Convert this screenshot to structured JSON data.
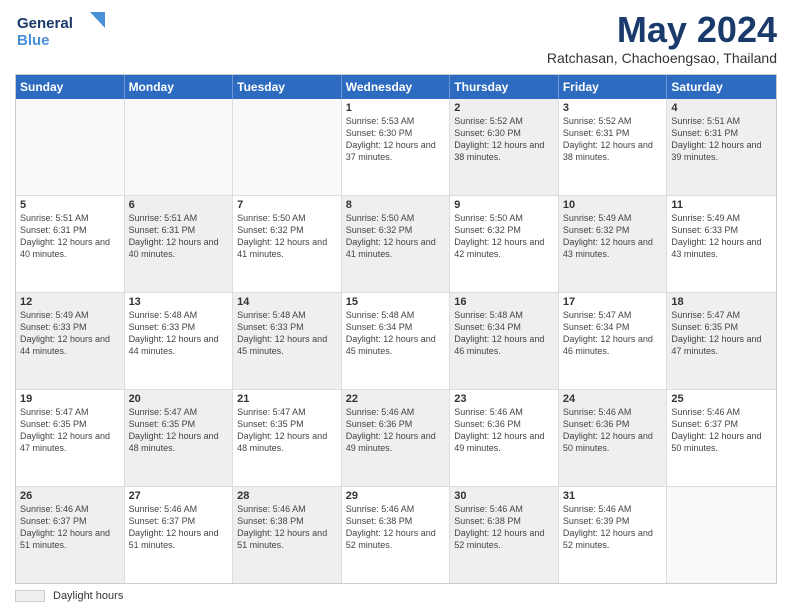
{
  "header": {
    "logo_line1": "General",
    "logo_line2": "Blue",
    "title": "May 2024",
    "subtitle": "Ratchasan, Chachoengsao, Thailand"
  },
  "calendar": {
    "days_of_week": [
      "Sunday",
      "Monday",
      "Tuesday",
      "Wednesday",
      "Thursday",
      "Friday",
      "Saturday"
    ],
    "rows": [
      [
        {
          "day": "",
          "info": "",
          "empty": true
        },
        {
          "day": "",
          "info": "",
          "empty": true
        },
        {
          "day": "",
          "info": "",
          "empty": true
        },
        {
          "day": "1",
          "info": "Sunrise: 5:53 AM\nSunset: 6:30 PM\nDaylight: 12 hours\nand 37 minutes.",
          "empty": false,
          "shaded": false
        },
        {
          "day": "2",
          "info": "Sunrise: 5:52 AM\nSunset: 6:30 PM\nDaylight: 12 hours\nand 38 minutes.",
          "empty": false,
          "shaded": true
        },
        {
          "day": "3",
          "info": "Sunrise: 5:52 AM\nSunset: 6:31 PM\nDaylight: 12 hours\nand 38 minutes.",
          "empty": false,
          "shaded": false
        },
        {
          "day": "4",
          "info": "Sunrise: 5:51 AM\nSunset: 6:31 PM\nDaylight: 12 hours\nand 39 minutes.",
          "empty": false,
          "shaded": true
        }
      ],
      [
        {
          "day": "5",
          "info": "Sunrise: 5:51 AM\nSunset: 6:31 PM\nDaylight: 12 hours\nand 40 minutes.",
          "empty": false,
          "shaded": false
        },
        {
          "day": "6",
          "info": "Sunrise: 5:51 AM\nSunset: 6:31 PM\nDaylight: 12 hours\nand 40 minutes.",
          "empty": false,
          "shaded": true
        },
        {
          "day": "7",
          "info": "Sunrise: 5:50 AM\nSunset: 6:32 PM\nDaylight: 12 hours\nand 41 minutes.",
          "empty": false,
          "shaded": false
        },
        {
          "day": "8",
          "info": "Sunrise: 5:50 AM\nSunset: 6:32 PM\nDaylight: 12 hours\nand 41 minutes.",
          "empty": false,
          "shaded": true
        },
        {
          "day": "9",
          "info": "Sunrise: 5:50 AM\nSunset: 6:32 PM\nDaylight: 12 hours\nand 42 minutes.",
          "empty": false,
          "shaded": false
        },
        {
          "day": "10",
          "info": "Sunrise: 5:49 AM\nSunset: 6:32 PM\nDaylight: 12 hours\nand 43 minutes.",
          "empty": false,
          "shaded": true
        },
        {
          "day": "11",
          "info": "Sunrise: 5:49 AM\nSunset: 6:33 PM\nDaylight: 12 hours\nand 43 minutes.",
          "empty": false,
          "shaded": false
        }
      ],
      [
        {
          "day": "12",
          "info": "Sunrise: 5:49 AM\nSunset: 6:33 PM\nDaylight: 12 hours\nand 44 minutes.",
          "empty": false,
          "shaded": true
        },
        {
          "day": "13",
          "info": "Sunrise: 5:48 AM\nSunset: 6:33 PM\nDaylight: 12 hours\nand 44 minutes.",
          "empty": false,
          "shaded": false
        },
        {
          "day": "14",
          "info": "Sunrise: 5:48 AM\nSunset: 6:33 PM\nDaylight: 12 hours\nand 45 minutes.",
          "empty": false,
          "shaded": true
        },
        {
          "day": "15",
          "info": "Sunrise: 5:48 AM\nSunset: 6:34 PM\nDaylight: 12 hours\nand 45 minutes.",
          "empty": false,
          "shaded": false
        },
        {
          "day": "16",
          "info": "Sunrise: 5:48 AM\nSunset: 6:34 PM\nDaylight: 12 hours\nand 46 minutes.",
          "empty": false,
          "shaded": true
        },
        {
          "day": "17",
          "info": "Sunrise: 5:47 AM\nSunset: 6:34 PM\nDaylight: 12 hours\nand 46 minutes.",
          "empty": false,
          "shaded": false
        },
        {
          "day": "18",
          "info": "Sunrise: 5:47 AM\nSunset: 6:35 PM\nDaylight: 12 hours\nand 47 minutes.",
          "empty": false,
          "shaded": true
        }
      ],
      [
        {
          "day": "19",
          "info": "Sunrise: 5:47 AM\nSunset: 6:35 PM\nDaylight: 12 hours\nand 47 minutes.",
          "empty": false,
          "shaded": false
        },
        {
          "day": "20",
          "info": "Sunrise: 5:47 AM\nSunset: 6:35 PM\nDaylight: 12 hours\nand 48 minutes.",
          "empty": false,
          "shaded": true
        },
        {
          "day": "21",
          "info": "Sunrise: 5:47 AM\nSunset: 6:35 PM\nDaylight: 12 hours\nand 48 minutes.",
          "empty": false,
          "shaded": false
        },
        {
          "day": "22",
          "info": "Sunrise: 5:46 AM\nSunset: 6:36 PM\nDaylight: 12 hours\nand 49 minutes.",
          "empty": false,
          "shaded": true
        },
        {
          "day": "23",
          "info": "Sunrise: 5:46 AM\nSunset: 6:36 PM\nDaylight: 12 hours\nand 49 minutes.",
          "empty": false,
          "shaded": false
        },
        {
          "day": "24",
          "info": "Sunrise: 5:46 AM\nSunset: 6:36 PM\nDaylight: 12 hours\nand 50 minutes.",
          "empty": false,
          "shaded": true
        },
        {
          "day": "25",
          "info": "Sunrise: 5:46 AM\nSunset: 6:37 PM\nDaylight: 12 hours\nand 50 minutes.",
          "empty": false,
          "shaded": false
        }
      ],
      [
        {
          "day": "26",
          "info": "Sunrise: 5:46 AM\nSunset: 6:37 PM\nDaylight: 12 hours\nand 51 minutes.",
          "empty": false,
          "shaded": true
        },
        {
          "day": "27",
          "info": "Sunrise: 5:46 AM\nSunset: 6:37 PM\nDaylight: 12 hours\nand 51 minutes.",
          "empty": false,
          "shaded": false
        },
        {
          "day": "28",
          "info": "Sunrise: 5:46 AM\nSunset: 6:38 PM\nDaylight: 12 hours\nand 51 minutes.",
          "empty": false,
          "shaded": true
        },
        {
          "day": "29",
          "info": "Sunrise: 5:46 AM\nSunset: 6:38 PM\nDaylight: 12 hours\nand 52 minutes.",
          "empty": false,
          "shaded": false
        },
        {
          "day": "30",
          "info": "Sunrise: 5:46 AM\nSunset: 6:38 PM\nDaylight: 12 hours\nand 52 minutes.",
          "empty": false,
          "shaded": true
        },
        {
          "day": "31",
          "info": "Sunrise: 5:46 AM\nSunset: 6:39 PM\nDaylight: 12 hours\nand 52 minutes.",
          "empty": false,
          "shaded": false
        },
        {
          "day": "",
          "info": "",
          "empty": true
        }
      ]
    ]
  },
  "footer": {
    "swatch_label": "Daylight hours"
  }
}
